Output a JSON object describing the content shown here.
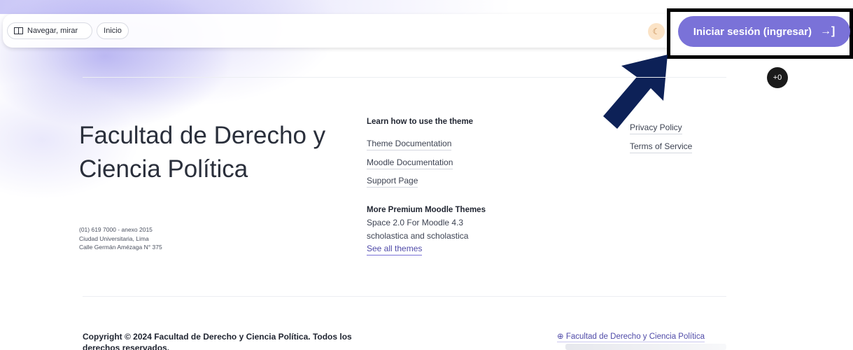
{
  "topbar": {
    "browse_label": "Navegar, mirar",
    "home_label": "Inicio",
    "theme_icon": "moon-icon",
    "login_label": "Iniciar sesión (ingresar)",
    "login_icon": "login-icon"
  },
  "badge": {
    "label": "+0"
  },
  "brand": {
    "title": "Facultad de Derecho y Ciencia Política",
    "phone": "(01) 619 7000 - anexo 2015",
    "address_line1": "Ciudad Universitaria, Lima",
    "address_line2": "Calle Germán Amézaga N° 375"
  },
  "learn": {
    "heading": "Learn how to use the theme",
    "links": [
      "Theme Documentation",
      "Moodle Documentation",
      "Support Page"
    ]
  },
  "premium": {
    "heading": "More Premium Moodle Themes",
    "line1": "Space 2.0 For Moodle 4.3",
    "line2": "scholastica and scholastica",
    "see_all": "See all themes"
  },
  "legal": {
    "links": [
      "Privacy Policy",
      "Terms of Service"
    ]
  },
  "footer": {
    "copyright": "Copyright © 2024 Facultad de Derecho y Ciencia Política. Todos los derechos reservados.",
    "site_link": "Facultad de Derecho y Ciencia Política",
    "site_icon": "globe-icon"
  },
  "colors": {
    "accent": "#7a72d8",
    "arrow": "#0d2157",
    "highlight_border": "#000000"
  }
}
